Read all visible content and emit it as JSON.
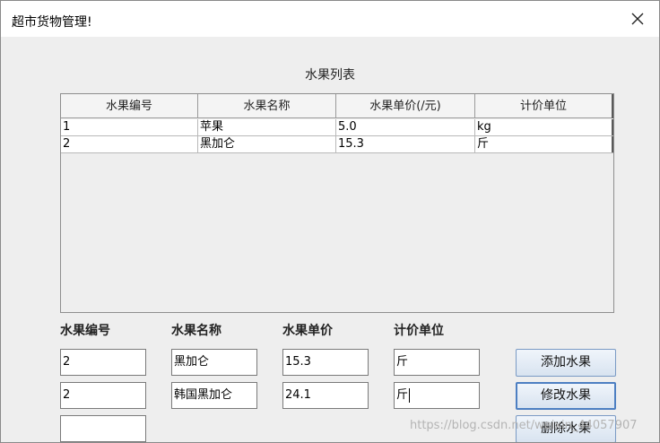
{
  "window": {
    "title": "超市货物管理!"
  },
  "table": {
    "title": "水果列表",
    "columns": [
      "水果编号",
      "水果名称",
      "水果单价(/元)",
      "计价单位"
    ],
    "rows": [
      [
        "1",
        "苹果",
        "5.0",
        "kg"
      ],
      [
        "2",
        "黑加仑",
        "15.3",
        "斤"
      ]
    ]
  },
  "form": {
    "labels": {
      "id": "水果编号",
      "name": "水果名称",
      "price": "水果单价",
      "unit": "计价单位"
    },
    "row1": {
      "id": "2",
      "name": "黑加仑",
      "price": "15.3",
      "unit": "斤"
    },
    "row2": {
      "id": "2",
      "name": "韩国黑加仑",
      "price": "24.1",
      "unit": "斤"
    },
    "row3": {
      "id": ""
    }
  },
  "buttons": {
    "add": "添加水果",
    "modify": "修改水果",
    "delete": "删除水果"
  },
  "watermark": "https://blog.csdn.net/weixin_44057907"
}
